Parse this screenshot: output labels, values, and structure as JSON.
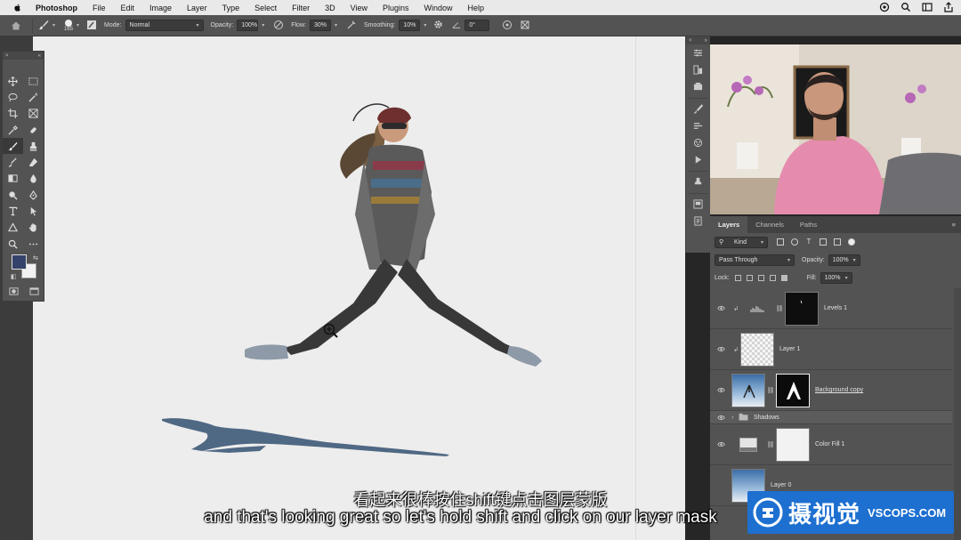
{
  "menubar": {
    "app": "Photoshop",
    "items": [
      "File",
      "Edit",
      "Image",
      "Layer",
      "Type",
      "Select",
      "Filter",
      "3D",
      "View",
      "Plugins",
      "Window",
      "Help"
    ]
  },
  "options": {
    "brush_size": "165",
    "mode_label": "Mode:",
    "mode_value": "Normal",
    "opacity_label": "Opacity:",
    "opacity_value": "100%",
    "flow_label": "Flow:",
    "flow_value": "30%",
    "smoothing_label": "Smoothing:",
    "smoothing_value": "10%",
    "angle_value": "0°"
  },
  "layers_panel": {
    "tabs": [
      "Layers",
      "Channels",
      "Paths"
    ],
    "filter_kind": "Kind",
    "blend_mode": "Pass Through",
    "opacity_label": "Opacity:",
    "opacity_value": "100%",
    "lock_label": "Lock:",
    "fill_label": "Fill:",
    "fill_value": "100%",
    "layers": [
      {
        "name": "Levels 1"
      },
      {
        "name": "Layer 1"
      },
      {
        "name": "Background copy"
      },
      {
        "name": "Shadows"
      },
      {
        "name": "Color Fill 1"
      },
      {
        "name": "Layer 0"
      }
    ]
  },
  "subtitles": {
    "cn": "看起来很棒按住shift键点击图层蒙版",
    "en": "and that's looking great so let's hold shift and click on our layer mask"
  },
  "watermark": {
    "cn": "摄视觉",
    "en": "VSCOPS.COM"
  },
  "colors": {
    "foreground": "#35436a",
    "background": "#f1f1f1",
    "watermark_blue": "#1d6fd0"
  }
}
